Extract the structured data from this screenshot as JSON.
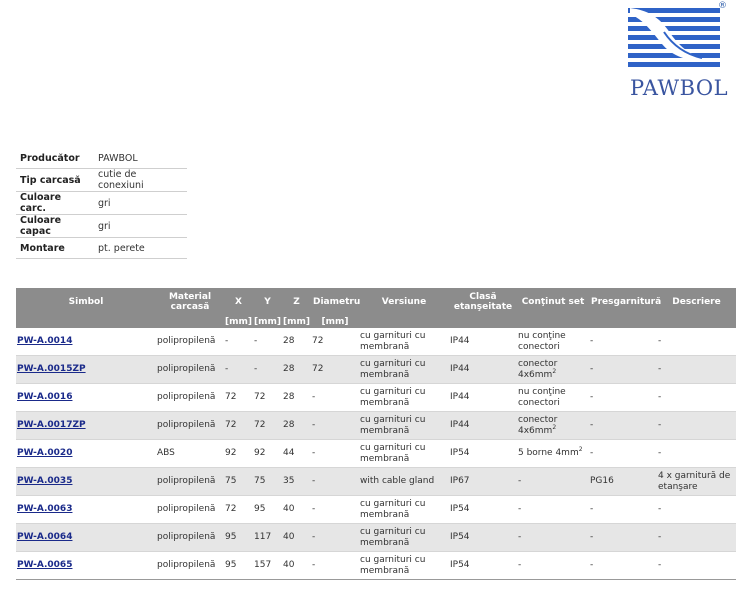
{
  "brand": {
    "name": "PAWBOL",
    "registered": "®",
    "color": "#3a55a0"
  },
  "properties": [
    {
      "key": "Producător",
      "value": "PAWBOL"
    },
    {
      "key": "Tip carcasă",
      "value": "cutie de conexiuni"
    },
    {
      "key": "Culoare carc.",
      "value": "gri"
    },
    {
      "key": "Culoare capac",
      "value": "gri"
    },
    {
      "key": "Montare",
      "value": "pt. perete"
    }
  ],
  "table": {
    "headers": {
      "simbol": "Simbol",
      "material": "Material carcasă",
      "x": "X",
      "y": "Y",
      "z": "Z",
      "diametru": "Diametru",
      "versiune": "Versiune",
      "clasa": "Clasă etanşeitate",
      "continut": "Conţinut set",
      "presgarnitura": "Presgarnitură",
      "descriere": "Descriere"
    },
    "units": {
      "x": "[mm]",
      "y": "[mm]",
      "z": "[mm]",
      "diametru": "[mm]"
    },
    "rows": [
      {
        "simbol": "PW-A.0014",
        "material": "polipropilenă",
        "x": "-",
        "y": "-",
        "z": "28",
        "diametru": "72",
        "versiune": "cu garnituri cu membrană",
        "clasa": "IP44",
        "continut": "nu conţine conectori",
        "continut_sup": "",
        "presgarnitura": "-",
        "descriere": "-"
      },
      {
        "simbol": "PW-A.0015ZP",
        "material": "polipropilenă",
        "x": "-",
        "y": "-",
        "z": "28",
        "diametru": "72",
        "versiune": "cu garnituri cu membrană",
        "clasa": "IP44",
        "continut": "conector 4x6mm",
        "continut_sup": "2",
        "presgarnitura": "-",
        "descriere": "-"
      },
      {
        "simbol": "PW-A.0016",
        "material": "polipropilenă",
        "x": "72",
        "y": "72",
        "z": "28",
        "diametru": "-",
        "versiune": "cu garnituri cu membrană",
        "clasa": "IP44",
        "continut": "nu conţine conectori",
        "continut_sup": "",
        "presgarnitura": "-",
        "descriere": "-"
      },
      {
        "simbol": "PW-A.0017ZP",
        "material": "polipropilenă",
        "x": "72",
        "y": "72",
        "z": "28",
        "diametru": "-",
        "versiune": "cu garnituri cu membrană",
        "clasa": "IP44",
        "continut": "conector 4x6mm",
        "continut_sup": "2",
        "presgarnitura": "-",
        "descriere": "-"
      },
      {
        "simbol": "PW-A.0020",
        "material": "ABS",
        "x": "92",
        "y": "92",
        "z": "44",
        "diametru": "-",
        "versiune": "cu garnituri cu membrană",
        "clasa": "IP54",
        "continut": "5 borne 4mm",
        "continut_sup": "2",
        "presgarnitura": "-",
        "descriere": "-"
      },
      {
        "simbol": "PW-A.0035",
        "material": "polipropilenă",
        "x": "75",
        "y": "75",
        "z": "35",
        "diametru": "-",
        "versiune": "with cable gland",
        "clasa": "IP67",
        "continut": "-",
        "continut_sup": "",
        "presgarnitura": "PG16",
        "descriere": "4 x garnitură de etanşare"
      },
      {
        "simbol": "PW-A.0063",
        "material": "polipropilenă",
        "x": "72",
        "y": "95",
        "z": "40",
        "diametru": "-",
        "versiune": "cu garnituri cu membrană",
        "clasa": "IP54",
        "continut": "-",
        "continut_sup": "",
        "presgarnitura": "-",
        "descriere": "-"
      },
      {
        "simbol": "PW-A.0064",
        "material": "polipropilenă",
        "x": "95",
        "y": "117",
        "z": "40",
        "diametru": "-",
        "versiune": "cu garnituri cu membrană",
        "clasa": "IP54",
        "continut": "-",
        "continut_sup": "",
        "presgarnitura": "-",
        "descriere": "-"
      },
      {
        "simbol": "PW-A.0065",
        "material": "polipropilenă",
        "x": "95",
        "y": "157",
        "z": "40",
        "diametru": "-",
        "versiune": "cu garnituri cu membrană",
        "clasa": "IP54",
        "continut": "-",
        "continut_sup": "",
        "presgarnitura": "-",
        "descriere": "-"
      }
    ]
  }
}
